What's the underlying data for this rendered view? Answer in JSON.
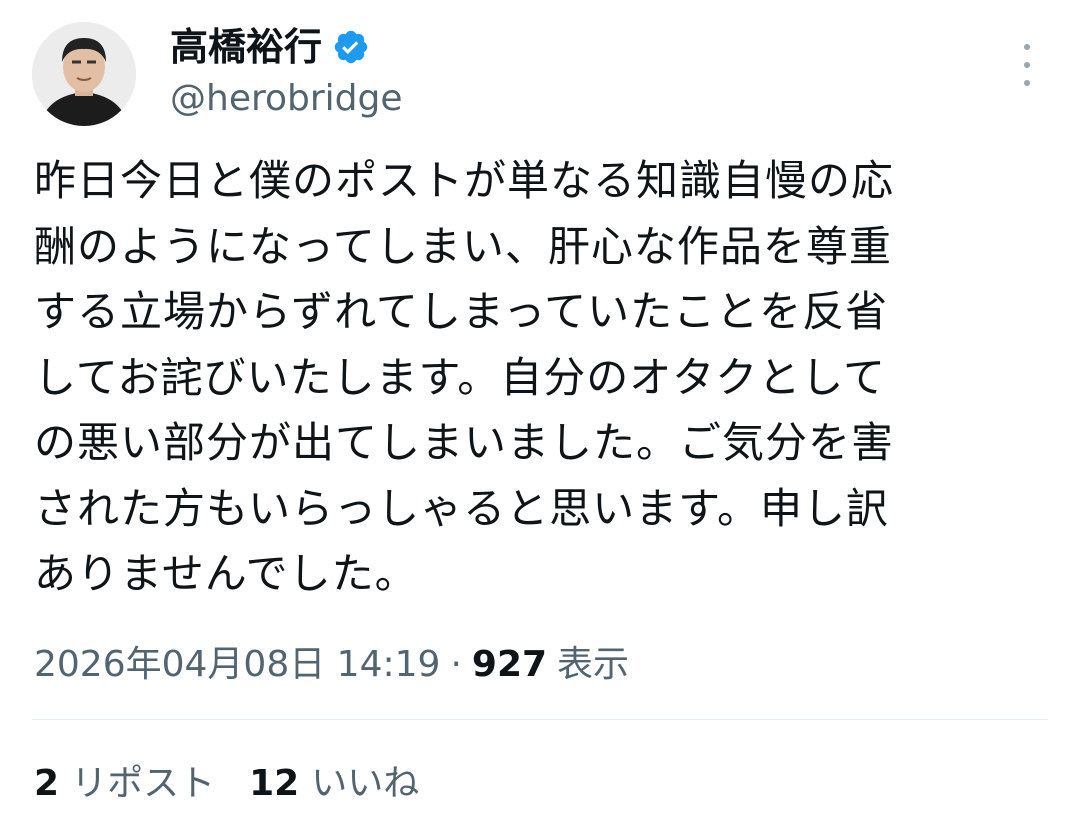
{
  "author": {
    "display_name": "高橋裕行",
    "handle": "@herobridge"
  },
  "icons": {
    "avatar": "avatar-photo",
    "verified": "verified-badge-icon",
    "more": "more-vertical-icon"
  },
  "colors": {
    "verified_blue": "#1d9bf0",
    "secondary_text": "#536471",
    "primary_text": "#0f1419"
  },
  "tweet": {
    "text": "昨日今日と僕のポストが単なる知識自慢の応\n酬のようになってしまい、肝心な作品を尊重\nする立場からずれてしまっていたことを反省\nしてお詫びいたします。自分のオタクとして\nの悪い部分が出てしまいました。ご気分を害\nされた方もいらっしゃると思います。申し訳\nありませんでした。"
  },
  "meta": {
    "timestamp": "2026年04月08日 14:19",
    "separator": "·",
    "views_count": "927",
    "views_label": "表示"
  },
  "stats": {
    "reposts_count": "2",
    "reposts_label": "リポスト",
    "likes_count": "12",
    "likes_label": "いいね"
  }
}
